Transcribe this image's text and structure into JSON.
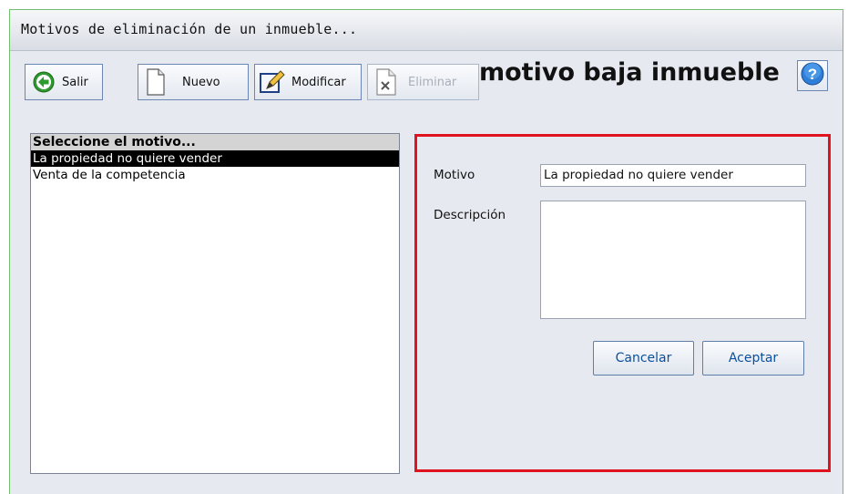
{
  "window": {
    "title": "Motivos de eliminación de un inmueble..."
  },
  "toolbar": {
    "salir_label": "Salir",
    "nuevo_label": "Nuevo",
    "modificar_label": "Modificar",
    "eliminar_label": "Eliminar",
    "heading": "motivo baja inmueble",
    "icons": {
      "salir": "back-arrow-icon",
      "nuevo": "new-document-icon",
      "modificar": "edit-icon",
      "eliminar": "delete-document-icon",
      "help": "help-icon"
    }
  },
  "list": {
    "header": "Seleccione el motivo...",
    "items": [
      "La propiedad no quiere vender",
      "Venta de la competencia"
    ],
    "selected": "La propiedad no quiere vender"
  },
  "form": {
    "motivo_label": "Motivo",
    "motivo_value": "La propiedad no quiere vender",
    "descripcion_label": "Descripción",
    "descripcion_value": "",
    "cancelar_label": "Cancelar",
    "aceptar_label": "Aceptar"
  },
  "colors": {
    "highlight_border": "#e0141e",
    "selection_bg": "#000000",
    "button_text": "#0b4f9e",
    "window_border": "#6fbf6f"
  }
}
